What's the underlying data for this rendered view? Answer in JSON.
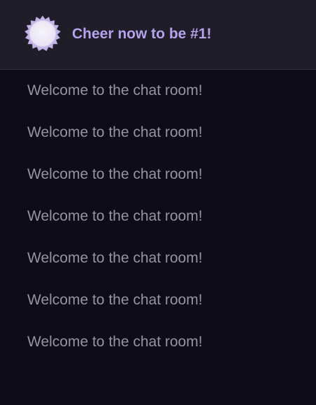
{
  "header": {
    "cheer_text": "Cheer now to be #1!",
    "badge_icon": "badge-icon",
    "accent": "#b5a2ec"
  },
  "messages": [
    {
      "text": "Welcome to the chat room!"
    },
    {
      "text": "Welcome to the chat room!"
    },
    {
      "text": "Welcome to the chat room!"
    },
    {
      "text": "Welcome to the chat room!"
    },
    {
      "text": "Welcome to the chat room!"
    },
    {
      "text": "Welcome to the chat room!"
    },
    {
      "text": "Welcome to the chat room!"
    }
  ]
}
